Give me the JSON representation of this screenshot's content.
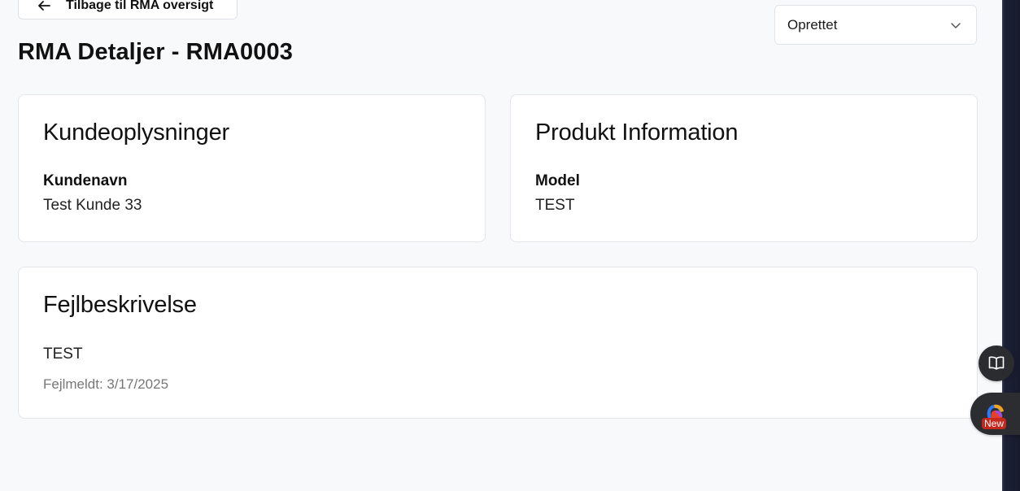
{
  "header": {
    "back_button_label": "Tilbage til RMA oversigt",
    "title": "RMA Detaljer - RMA0003",
    "status_select_value": "Oprettet"
  },
  "customer_card": {
    "title": "Kundeoplysninger",
    "field_label": "Kundenavn",
    "field_value": "Test Kunde 33"
  },
  "product_card": {
    "title": "Produkt Information",
    "field_label": "Model",
    "field_value": "TEST"
  },
  "error_card": {
    "title": "Fejlbeskrivelse",
    "description": "TEST",
    "reported_date": "Fejlmeldt: 3/17/2025"
  },
  "side_widgets": {
    "book_icon": "book-open-icon",
    "copilot_icon": "copilot-icon",
    "copilot_badge": "New"
  },
  "colors": {
    "page_background": "#f8f9fb",
    "card_background": "#ffffff",
    "card_border": "#e3e6ea",
    "badge_red": "#c4271c",
    "widget_dark": "#2b2d31"
  }
}
